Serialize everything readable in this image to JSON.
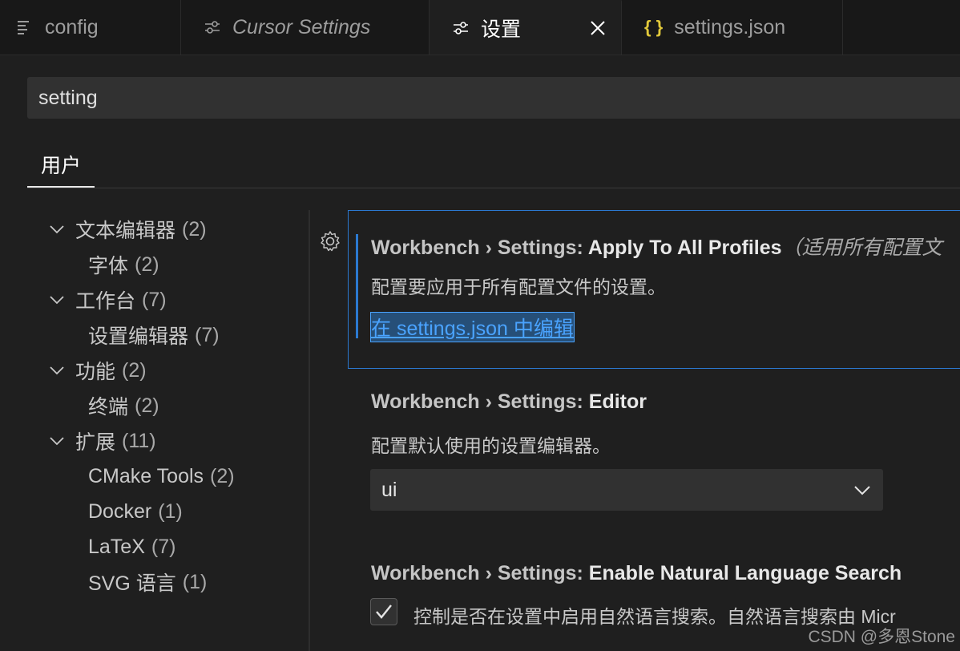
{
  "tabs": [
    {
      "label": "config",
      "icon": "list-icon",
      "active": false,
      "italic": false
    },
    {
      "label": "Cursor Settings",
      "icon": "sliders-icon",
      "active": false,
      "italic": true
    },
    {
      "label": "设置",
      "icon": "sliders-icon",
      "active": true,
      "italic": false
    },
    {
      "label": "settings.json",
      "icon": "json-braces-icon",
      "active": false,
      "italic": false
    }
  ],
  "search": {
    "value": "setting"
  },
  "scope": {
    "user_label": "用户"
  },
  "toc": [
    {
      "label": "文本编辑器",
      "count": "(2)",
      "expanded": true,
      "level": 0
    },
    {
      "label": "字体",
      "count": "(2)",
      "level": 1
    },
    {
      "label": "工作台",
      "count": "(7)",
      "expanded": true,
      "level": 0
    },
    {
      "label": "设置编辑器",
      "count": "(7)",
      "level": 1
    },
    {
      "label": "功能",
      "count": "(2)",
      "expanded": true,
      "level": 0
    },
    {
      "label": "终端",
      "count": "(2)",
      "level": 1
    },
    {
      "label": "扩展",
      "count": "(11)",
      "expanded": true,
      "level": 0
    },
    {
      "label": "CMake Tools",
      "count": "(2)",
      "level": 1
    },
    {
      "label": "Docker",
      "count": "(1)",
      "level": 1
    },
    {
      "label": "LaTeX",
      "count": "(7)",
      "level": 1
    },
    {
      "label": "SVG 语言",
      "count": "(1)",
      "level": 1
    }
  ],
  "settings": {
    "apply_all": {
      "category": "Workbench › Settings: ",
      "name": "Apply To All Profiles",
      "note": "（适用所有配置文",
      "description": "配置要应用于所有配置文件的设置。",
      "link": "在 settings.json 中编辑"
    },
    "editor": {
      "category": "Workbench › Settings: ",
      "name": "Editor",
      "description": "配置默认使用的设置编辑器。",
      "value": "ui"
    },
    "nls": {
      "category": "Workbench › Settings: ",
      "name": "Enable Natural Language Search",
      "description": "控制是否在设置中启用自然语言搜索。自然语言搜索由 Micr",
      "checked": true
    }
  },
  "watermark": "CSDN @多恩Stone",
  "colors": {
    "accent": "#2b79d1",
    "link": "#4aa3ff",
    "background": "#1f1f1f",
    "tabbar": "#181818"
  }
}
